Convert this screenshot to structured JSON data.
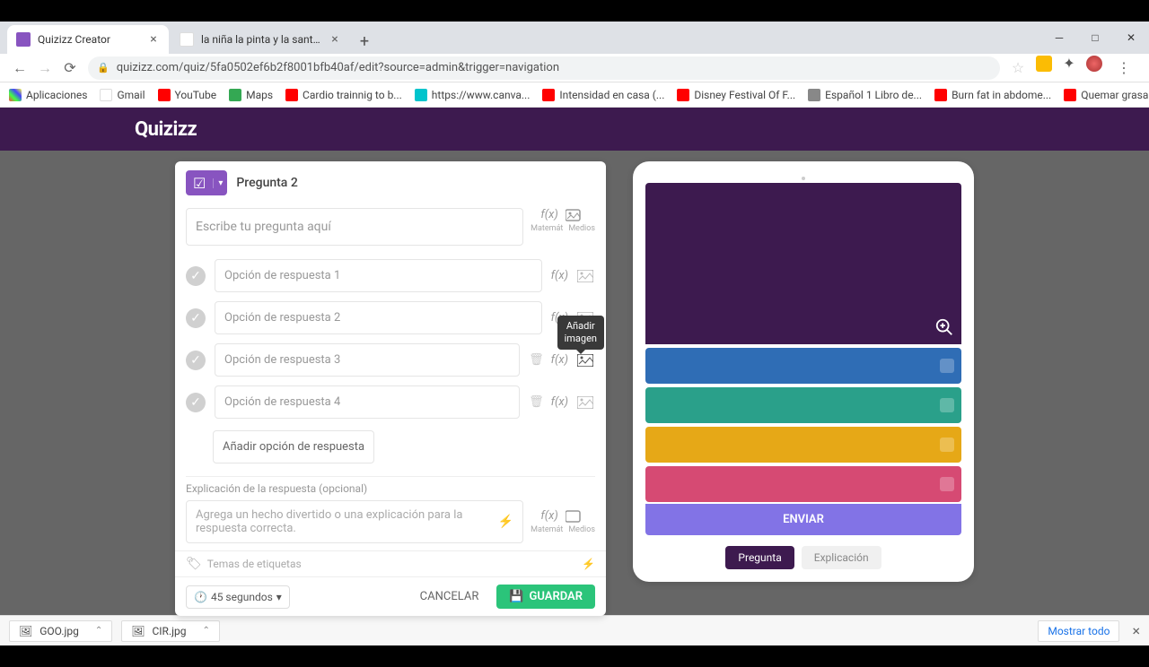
{
  "tabs": [
    {
      "title": "Quizizz Creator",
      "favicon": "#8854c0"
    },
    {
      "title": "la niña la pinta y la santa maria - ",
      "favicon": "#4285f4"
    }
  ],
  "url": "quizizz.com/quiz/5fa0502ef6b2f8001bfb40af/edit?source=admin&trigger=navigation",
  "bookmarks": [
    {
      "label": "Aplicaciones",
      "color": "#666"
    },
    {
      "label": "Gmail",
      "color": "#4285f4"
    },
    {
      "label": "YouTube",
      "color": "#ff0000"
    },
    {
      "label": "Maps",
      "color": "#34a853"
    },
    {
      "label": "Cardio trainnig to b...",
      "color": "#ff0000"
    },
    {
      "label": "https://www.canva...",
      "color": "#00c4cc"
    },
    {
      "label": "Intensidad en casa (...",
      "color": "#ff0000"
    },
    {
      "label": "Disney Festival Of F...",
      "color": "#ff0000"
    },
    {
      "label": "Español 1 Libro de...",
      "color": "#888"
    },
    {
      "label": "Burn fat in abdome...",
      "color": "#ff0000"
    },
    {
      "label": "Quemar grasa en a...",
      "color": "#ff0000"
    }
  ],
  "logo": "Quizizz",
  "editor": {
    "question_label": "Pregunta 2",
    "question_placeholder": "Escribe tu pregunta aquí",
    "fx": "f(x)",
    "math_label": "Matemát",
    "media_label": "Medios",
    "options": [
      {
        "placeholder": "Opción de respuesta 1",
        "deletable": false
      },
      {
        "placeholder": "Opción de respuesta 2",
        "deletable": false
      },
      {
        "placeholder": "Opción de respuesta 3",
        "deletable": true
      },
      {
        "placeholder": "Opción de respuesta 4",
        "deletable": true
      }
    ],
    "add_option": "Añadir opción de respuesta",
    "tooltip": "Añadir\nimagen",
    "explain_label": "Explicación de la respuesta (opcional)",
    "explain_placeholder": "Agrega un hecho divertido o una explicación para la respuesta correcta.",
    "tags_placeholder": "Temas de etiquetas",
    "time": "45 segundos",
    "cancel": "CANCELAR",
    "save": "GUARDAR"
  },
  "preview": {
    "opt_colors": [
      "#2f6db5",
      "#2aa08a",
      "#e6a817",
      "#d64a73"
    ],
    "submit": "ENVIAR",
    "tab_question": "Pregunta",
    "tab_explain": "Explicación"
  },
  "downloads": {
    "items": [
      "GOO.jpg",
      "CIR.jpg"
    ],
    "show_all": "Mostrar todo"
  }
}
